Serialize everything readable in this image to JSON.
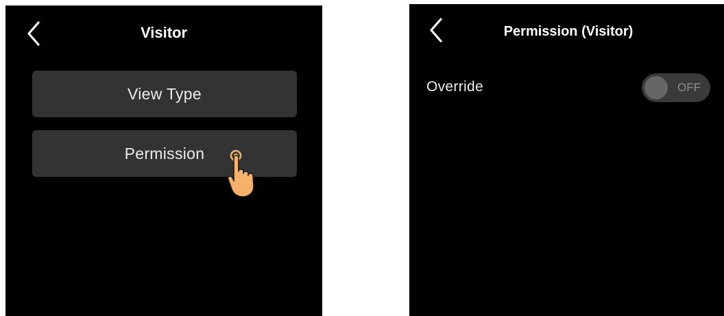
{
  "visitor_screen": {
    "title": "Visitor",
    "back_icon": "chevron-left-icon",
    "menu": [
      {
        "label": "View Type"
      },
      {
        "label": "Permission"
      }
    ],
    "pointer_icon": "tap-hand-icon"
  },
  "permission_screen": {
    "title": "Permission (Visitor)",
    "back_icon": "chevron-left-icon",
    "override": {
      "label": "Override",
      "state": "OFF"
    }
  },
  "colors": {
    "screen_bg": "#000000",
    "button_bg": "#333333",
    "text": "#ececec",
    "toggle_bg": "#3a3a3a",
    "toggle_knob": "#666666",
    "hand": "#f6b26b"
  }
}
